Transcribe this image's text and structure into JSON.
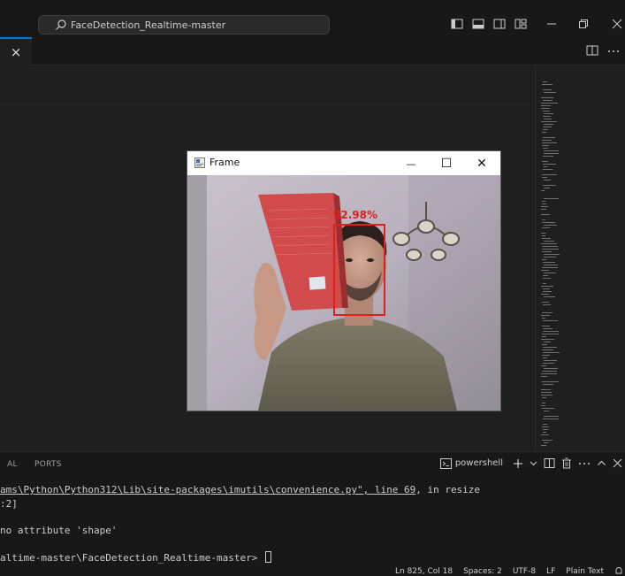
{
  "titlebar": {
    "search_text": "FaceDetection_Realtime-master",
    "icons": [
      "search-icon",
      "toggle-primary-sidebar-icon",
      "toggle-panel-icon",
      "toggle-secondary-sidebar-icon",
      "customize-layout-icon",
      "minimize-icon",
      "restore-icon",
      "close-icon"
    ]
  },
  "tabbar": {
    "tab_close_label": "×",
    "right_icons": [
      "split-editor-icon",
      "more-actions-icon"
    ]
  },
  "frame_window": {
    "title": "Frame",
    "minimize_label": "—",
    "maximize_label": "☐",
    "close_label": "✕",
    "detection_label": "92.98%",
    "box_color": "#e0201c"
  },
  "panel": {
    "tabs": [
      "AL",
      "PORTS"
    ],
    "shell_label": "powershell",
    "actions": [
      "new-terminal-icon",
      "dropdown-icon",
      "split-terminal-icon",
      "kill-terminal-icon",
      "more-icon",
      "maximize-panel-icon",
      "close-panel-icon"
    ]
  },
  "terminal": {
    "line1_prefix": "ams\\Python\\Python312\\Lib\\site-packages\\imutils\\convenience.py\", line 69",
    "line1_suffix": ", in resize",
    "line2": ":2]",
    "line3": "no attribute 'shape'",
    "line4": "altime-master\\FaceDetection_Realtime-master> "
  },
  "statusbar": {
    "position": "Ln 825, Col 18",
    "spaces": "Spaces: 2",
    "encoding": "UTF-8",
    "eol": "LF",
    "language": "Plain Text"
  },
  "colors": {
    "accent": "#0078d4",
    "background": "#1f1f1f",
    "titlebar": "#181818"
  }
}
